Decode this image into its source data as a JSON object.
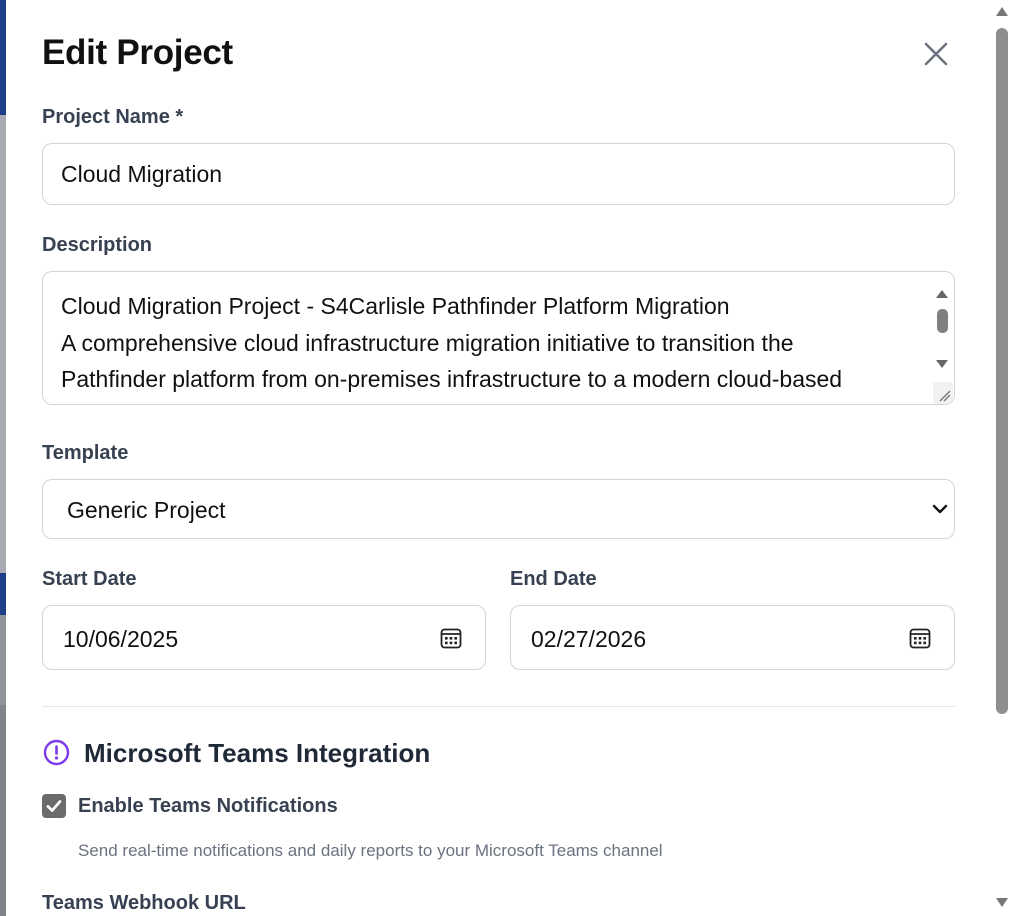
{
  "modal": {
    "title": "Edit Project",
    "close_icon": "close-icon"
  },
  "form": {
    "project_name": {
      "label": "Project Name *",
      "value": "Cloud Migration"
    },
    "description": {
      "label": "Description",
      "lines": [
        "Cloud Migration Project - S4Carlisle Pathfinder Platform Migration",
        "A comprehensive cloud infrastructure migration initiative to transition the",
        "Pathfinder platform from on-premises infrastructure to a modern cloud-based"
      ]
    },
    "template": {
      "label": "Template",
      "value": "Generic Project",
      "icon": "chevron-down-icon"
    },
    "start_date": {
      "label": "Start Date",
      "value": "10/06/2025",
      "icon": "calendar-icon"
    },
    "end_date": {
      "label": "End Date",
      "value": "02/27/2026",
      "icon": "calendar-icon"
    }
  },
  "teams": {
    "section_title": "Microsoft Teams Integration",
    "section_icon": "alert-circle-icon",
    "accent_color": "#7c3aed",
    "enable_label": "Enable Teams Notifications",
    "enable_checked": true,
    "help_text": "Send real-time notifications and daily reports to your Microsoft Teams channel",
    "webhook_label": "Teams Webhook URL"
  }
}
